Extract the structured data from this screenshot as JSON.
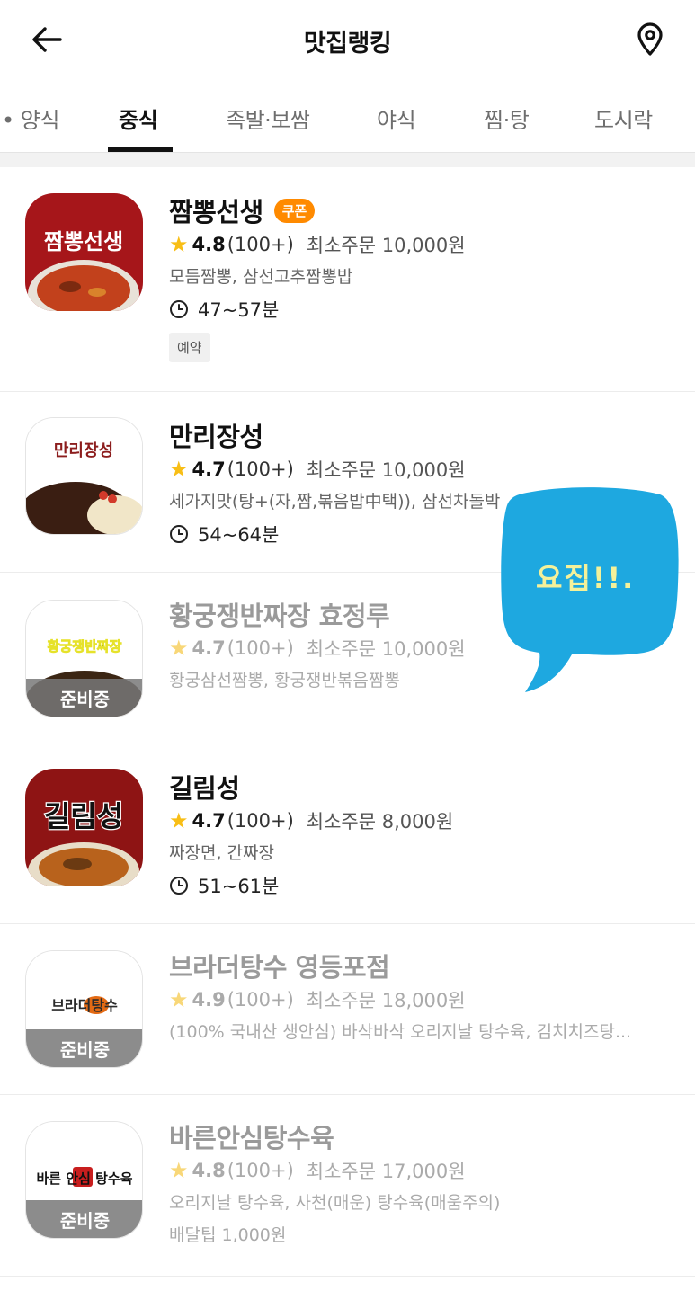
{
  "header": {
    "title": "맛집랭킹"
  },
  "tabs": [
    {
      "label": "• 양식"
    },
    {
      "label": "중식"
    },
    {
      "label": "족발·보쌈"
    },
    {
      "label": "야식"
    },
    {
      "label": "찜·탕"
    },
    {
      "label": "도시락"
    }
  ],
  "restaurants": [
    {
      "name": "짬뽕선생",
      "thumb_text": "짬뽕선생",
      "coupon": "쿠폰",
      "score": "4.8",
      "count": "(100+)",
      "min_order": "최소주문 10,000원",
      "menu": "모듬짬뽕, 삼선고추짬뽕밥",
      "delivery_time": "47~57분",
      "tag": "예약"
    },
    {
      "name": "만리장성",
      "thumb_text": "만리장성",
      "score": "4.7",
      "count": "(100+)",
      "min_order": "최소주문 10,000원",
      "menu": "세가지맛(탕+(자,짬,볶음밥中택)), 삼선차돌박",
      "delivery_time": "54~64분"
    },
    {
      "name": "황궁쟁반짜장 효정루",
      "thumb_text": "황궁쟁반짜장",
      "status": "준비중",
      "score": "4.7",
      "count": "(100+)",
      "min_order": "최소주문 10,000원",
      "menu": "황궁삼선짬뽕, 황궁쟁반볶음짬뽕"
    },
    {
      "name": "길림성",
      "thumb_text": "길림성",
      "score": "4.7",
      "count": "(100+)",
      "min_order": "최소주문 8,000원",
      "menu": "짜장면, 간짜장",
      "delivery_time": "51~61분"
    },
    {
      "name": "브라더탕수 영등포점",
      "thumb_text": "브라더탕수",
      "status": "준비중",
      "score": "4.9",
      "count": "(100+)",
      "min_order": "최소주문 18,000원",
      "menu": "(100% 국내산 생안심) 바삭바삭 오리지날 탕수육, 김치치즈탕..."
    },
    {
      "name": "바른안심탕수육",
      "thumb_text": "바른 안심 탕수육",
      "status": "준비중",
      "score": "4.8",
      "count": "(100+)",
      "min_order": "최소주문 17,000원",
      "menu": "오리지날 탕수육, 사천(매운) 탕수육(매움주의)",
      "delivery_tip": "배달팁 1,000원"
    }
  ],
  "sticker": {
    "text": "요집!!."
  },
  "colors": {
    "accent_orange": "#ff8a00",
    "star_yellow": "#f8be16",
    "sticker_blue": "#1ea8e0"
  }
}
